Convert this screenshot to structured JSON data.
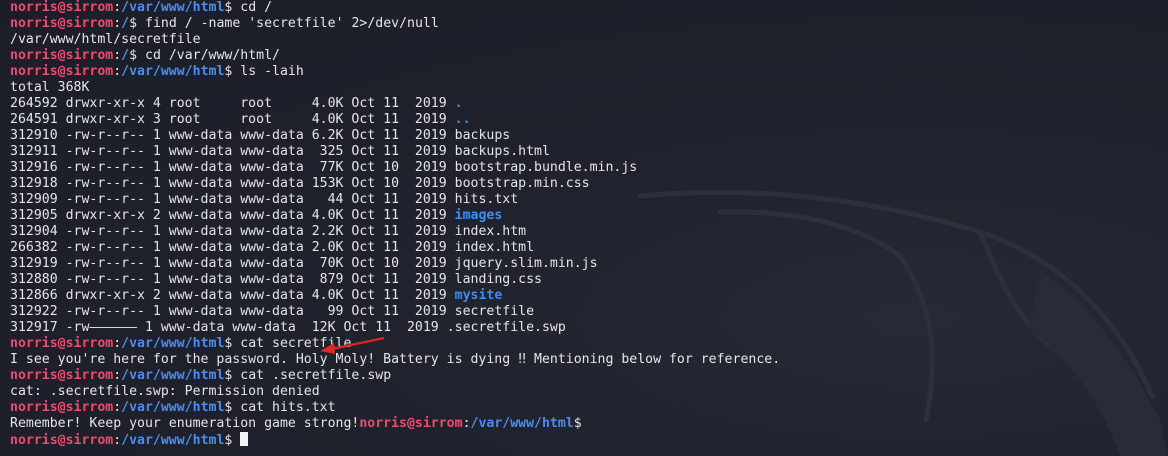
{
  "prompt": {
    "user": "norris@sirrom",
    "colon": ":",
    "dollar": "$ "
  },
  "colors": {
    "background": "#1d2029",
    "user": "#ee4b70",
    "path": "#4a8df0",
    "directory": "#3f8ef5",
    "text": "#e6e6e6",
    "arrow": "#e02525"
  },
  "lines": [
    {
      "type": "prompt",
      "path": "/var/www/html",
      "cmd": "cd /"
    },
    {
      "type": "prompt",
      "path": "/",
      "cmd": "find / -name 'secretfile' 2>/dev/null"
    },
    {
      "type": "output",
      "text": "/var/www/html/secretfile"
    },
    {
      "type": "prompt",
      "path": "/",
      "cmd": "cd /var/www/html/"
    },
    {
      "type": "prompt",
      "path": "/var/www/html",
      "cmd": "ls -laih"
    },
    {
      "type": "output",
      "text": "total 368K"
    },
    {
      "type": "entry",
      "meta": "264592 drwxr-xr-x 4 root     root     4.0K Oct 11  2019 ",
      "name": ".",
      "dir": true
    },
    {
      "type": "entry",
      "meta": "264591 drwxr-xr-x 3 root     root     4.0K Oct 11  2019 ",
      "name": "..",
      "dir": true
    },
    {
      "type": "entry",
      "meta": "312910 -rw-r--r-- 1 www-data www-data 6.2K Oct 11  2019 ",
      "name": "backups",
      "dir": false
    },
    {
      "type": "entry",
      "meta": "312911 -rw-r--r-- 1 www-data www-data  325 Oct 11  2019 ",
      "name": "backups.html",
      "dir": false
    },
    {
      "type": "entry",
      "meta": "312916 -rw-r--r-- 1 www-data www-data  77K Oct 10  2019 ",
      "name": "bootstrap.bundle.min.js",
      "dir": false
    },
    {
      "type": "entry",
      "meta": "312918 -rw-r--r-- 1 www-data www-data 153K Oct 10  2019 ",
      "name": "bootstrap.min.css",
      "dir": false
    },
    {
      "type": "entry",
      "meta": "312909 -rw-r--r-- 1 www-data www-data   44 Oct 11  2019 ",
      "name": "hits.txt",
      "dir": false
    },
    {
      "type": "entry",
      "meta": "312905 drwxr-xr-x 2 www-data www-data 4.0K Oct 11  2019 ",
      "name": "images",
      "dir": true
    },
    {
      "type": "entry",
      "meta": "312904 -rw-r--r-- 1 www-data www-data 2.2K Oct 11  2019 ",
      "name": "index.htm",
      "dir": false
    },
    {
      "type": "entry",
      "meta": "266382 -rw-r--r-- 1 www-data www-data 2.0K Oct 11  2019 ",
      "name": "index.html",
      "dir": false
    },
    {
      "type": "entry",
      "meta": "312919 -rw-r--r-- 1 www-data www-data  70K Oct 10  2019 ",
      "name": "jquery.slim.min.js",
      "dir": false
    },
    {
      "type": "entry",
      "meta": "312880 -rw-r--r-- 1 www-data www-data  879 Oct 11  2019 ",
      "name": "landing.css",
      "dir": false
    },
    {
      "type": "entry",
      "meta": "312866 drwxr-xr-x 2 www-data www-data 4.0K Oct 11  2019 ",
      "name": "mysite",
      "dir": true
    },
    {
      "type": "entry",
      "meta": "312922 -rw-r--r-- 1 www-data www-data   99 Oct 11  2019 ",
      "name": "secretfile",
      "dir": false
    },
    {
      "type": "entry",
      "meta": "312917 -rw—————— 1 www-data www-data  12K Oct 11  2019 ",
      "name": ".secretfile.swp",
      "dir": false
    },
    {
      "type": "prompt",
      "path": "/var/www/html",
      "cmd": "cat secretfile"
    },
    {
      "type": "output",
      "text": "I see you're here for the password. Holy Moly! Battery is dying ‼ Mentioning below for reference."
    },
    {
      "type": "prompt",
      "path": "/var/www/html",
      "cmd": "cat .secretfile.swp"
    },
    {
      "type": "output",
      "text": "cat: .secretfile.swp: Permission denied"
    },
    {
      "type": "prompt",
      "path": "/var/www/html",
      "cmd": "cat hits.txt"
    },
    {
      "type": "mixed",
      "text": "Remember! Keep your enumeration game strong!",
      "path": "/var/www/html"
    },
    {
      "type": "prompt",
      "path": "/var/www/html",
      "cmd": "",
      "cursor": true
    }
  ]
}
